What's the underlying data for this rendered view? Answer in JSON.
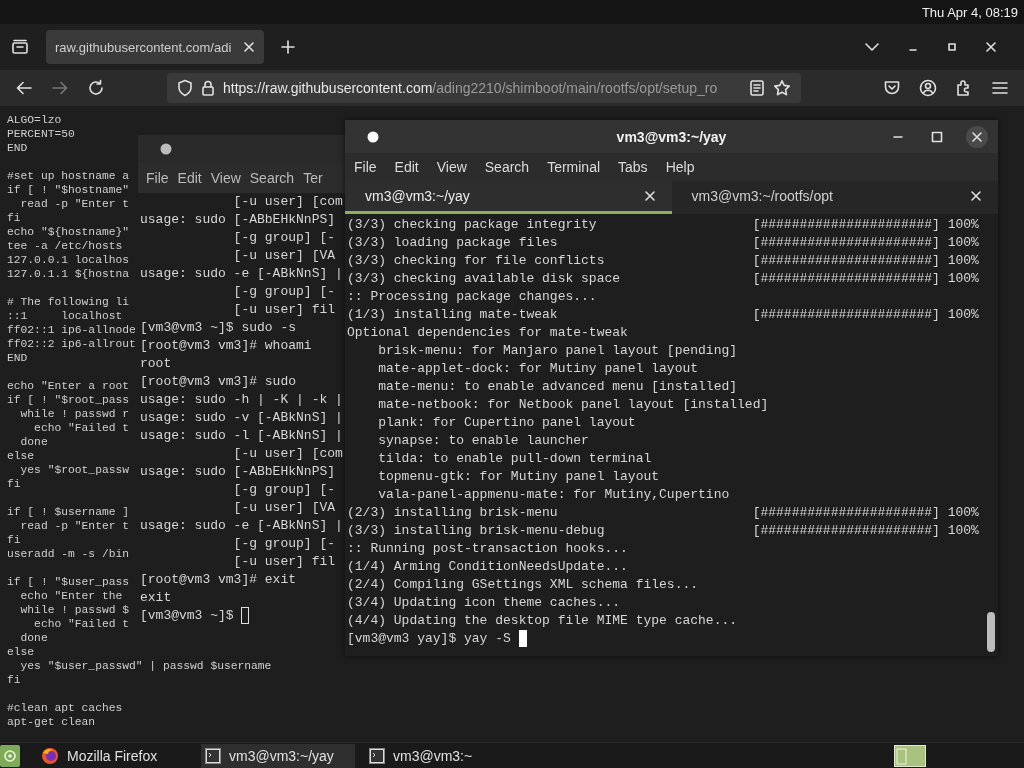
{
  "top_bar": {
    "clock": "Thu Apr  4, 08:19"
  },
  "browser": {
    "tabs": [
      {
        "title": "raw.githubusercontent.com/adi",
        "selected": true
      }
    ],
    "forward": {
      "disabled": true
    },
    "address": {
      "host": "https://raw.githubusercontent.com",
      "path": "/ading2210/shimboot/main/rootfs/opt/setup_ro"
    },
    "page_blocks": [
      [
        "ALGO=lzo",
        "PERCENT=50",
        "END"
      ],
      [
        "#set up hostname a",
        "if [ ! \"$hostname\"",
        "  read -p \"Enter t",
        "fi",
        "echo \"${hostname}\"",
        "tee -a /etc/hosts",
        "127.0.0.1 localhos",
        "127.0.1.1 ${hostna"
      ],
      [
        "# The following li",
        "::1     localhost",
        "ff02::1 ip6-allnode",
        "ff02::2 ip6-allrout",
        "END"
      ],
      [
        "echo \"Enter a root",
        "if [ ! \"$root_pass",
        "  while ! passwd r",
        "    echo \"Failed t",
        "  done",
        "else",
        "  yes \"$root_passw",
        "fi"
      ],
      [
        "if [ ! $username ]",
        "  read -p \"Enter t",
        "fi",
        "useradd -m -s /bin"
      ],
      [
        "if [ ! \"$user_pass",
        "  echo \"Enter the",
        "  while ! passwd $",
        "    echo \"Failed t",
        "  done",
        "else",
        "  yes \"$user_passwd\" | passwd $username",
        "fi"
      ],
      [
        "#clean apt caches",
        "apt-get clean"
      ]
    ]
  },
  "terminals": [
    {
      "focused": false,
      "menu": [
        "File",
        "Edit",
        "View",
        "Search",
        "Ter"
      ],
      "lines": [
        {
          "text": "            [-u user] [com"
        },
        {
          "text": "usage: sudo [-ABbEHkNnPS]"
        },
        {
          "text": "            [-g group] [-"
        },
        {
          "text": "            [-u user] [VA"
        },
        {
          "text": "usage: sudo -e [-ABkNnS] |"
        },
        {
          "text": "            [-g group] [-"
        },
        {
          "text": "            [-u user] fil"
        },
        {
          "text": "[vm3@vm3 ~]$ sudo -s"
        },
        {
          "text": "[root@vm3 vm3]# whoami"
        },
        {
          "text": "root"
        },
        {
          "text": "[root@vm3 vm3]# sudo"
        },
        {
          "text": "usage: sudo -h | -K | -k |"
        },
        {
          "text": "usage: sudo -v [-ABkNnS] |"
        },
        {
          "text": "usage: sudo -l [-ABkNnS] |"
        },
        {
          "text": "            [-u user] [com"
        },
        {
          "text": "usage: sudo [-ABbEHkNnPS]"
        },
        {
          "text": "            [-g group] [-"
        },
        {
          "text": "            [-u user] [VA"
        },
        {
          "text": "usage: sudo -e [-ABkNnS] |"
        },
        {
          "text": "            [-g group] [-"
        },
        {
          "text": "            [-u user] fil"
        },
        {
          "text": "[root@vm3 vm3]# exit"
        },
        {
          "text": "exit"
        },
        {
          "text": "[vm3@vm3 ~]$",
          "cursor": true
        }
      ]
    },
    {
      "focused": true,
      "title": "vm3@vm3:~/yay",
      "menu": [
        "File",
        "Edit",
        "View",
        "Search",
        "Terminal",
        "Tabs",
        "Help"
      ],
      "tabs": [
        {
          "label": "vm3@vm3:~/yay",
          "selected": true
        },
        {
          "label": "vm3@vm3:~/rootfs/opt",
          "selected": false
        }
      ],
      "lines": [
        {
          "kind": "progress",
          "text": "(3/3) checking package integrity",
          "bar": "[######################]",
          "percent": "100%"
        },
        {
          "kind": "progress",
          "text": "(3/3) loading package files",
          "bar": "[######################]",
          "percent": "100%"
        },
        {
          "kind": "progress",
          "text": "(3/3) checking for file conflicts",
          "bar": "[######################]",
          "percent": "100%"
        },
        {
          "kind": "progress",
          "text": "(3/3) checking available disk space",
          "bar": "[######################]",
          "percent": "100%"
        },
        {
          "text": ":: Processing package changes..."
        },
        {
          "kind": "progress",
          "text": "(1/3) installing mate-tweak",
          "bar": "[######################]",
          "percent": "100%"
        },
        {
          "text": "Optional dependencies for mate-tweak"
        },
        {
          "text": "    brisk-menu: for Manjaro panel layout [pending]"
        },
        {
          "text": "    mate-applet-dock: for Mutiny panel layout"
        },
        {
          "text": "    mate-menu: to enable advanced menu [installed]"
        },
        {
          "text": "    mate-netbook: for Netbook panel layout [installed]"
        },
        {
          "text": "    plank: for Cupertino panel layout"
        },
        {
          "text": "    synapse: to enable launcher"
        },
        {
          "text": "    tilda: to enable pull-down terminal"
        },
        {
          "text": "    topmenu-gtk: for Mutiny panel layout"
        },
        {
          "text": "    vala-panel-appmenu-mate: for Mutiny,Cupertino"
        },
        {
          "kind": "progress",
          "text": "(2/3) installing brisk-menu",
          "bar": "[######################]",
          "percent": "100%"
        },
        {
          "kind": "progress",
          "text": "(3/3) installing brisk-menu-debug",
          "bar": "[######################]",
          "percent": "100%"
        },
        {
          "text": ":: Running post-transaction hooks..."
        },
        {
          "text": "(1/4) Arming ConditionNeedsUpdate..."
        },
        {
          "text": "(2/4) Compiling GSettings XML schema files..."
        },
        {
          "text": "(3/4) Updating icon theme caches..."
        },
        {
          "text": "(4/4) Updating the desktop file MIME type cache..."
        },
        {
          "text": "[vm3@vm3 yay]$ yay -S",
          "cursor": true
        }
      ]
    }
  ],
  "taskbar": {
    "items": [
      {
        "kind": "firefox",
        "label": "Mozilla Firefox",
        "selected": false
      },
      {
        "kind": "terminal",
        "label": "vm3@vm3:~/yay",
        "selected": true
      },
      {
        "kind": "terminal",
        "label": "vm3@vm3:~",
        "selected": false
      }
    ]
  }
}
